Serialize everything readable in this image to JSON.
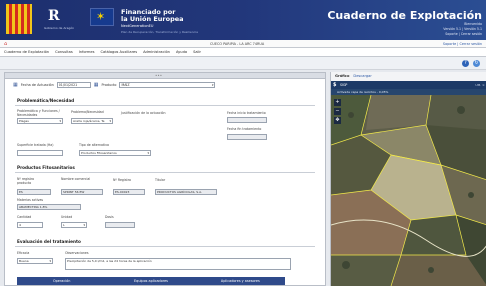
{
  "banner": {
    "logo_letter": "R",
    "logo_sub": "Gobierno de Aragón",
    "financing_line1": "Financiado por",
    "financing_line2": "la Unión Europea",
    "financing_line3": "NextGenerationEU",
    "programme": "Plan de Recuperación, Transformación y Resiliencia",
    "app_title": "Cuaderno de Explotación",
    "app_sub1": "Bienvenido",
    "app_sub2": "Versión 5.1 | Versión 5.1",
    "app_sub3": "Soporte | Cerrar sesión"
  },
  "topbar": {
    "center_text": "CUECO PARIPIA - LA ARC 74RUA",
    "right_text": "Soporte | Cerrar sesión"
  },
  "menu": [
    "Cuaderno de Explotación",
    "Consultas",
    "Informes",
    "Catálogos Auxiliares",
    "Administración",
    "Ayuda",
    "Salir"
  ],
  "form": {
    "fecha_label": "Fecha de Actuación",
    "fecha_value": "01/01/2021",
    "producto_label": "Producto",
    "producto_value": "MAÍZ",
    "section_problema": "Problemática/Necesidad",
    "problematica_label": "Problemática y Funciones / Necesidades",
    "problematica_value": "Plagas",
    "problema_label": "Problema/Necesidad",
    "problema_value": "Araña roja/ácaros, Te",
    "justificacion_label": "Justificación de la actuación",
    "fecha_inicio_label": "Fecha inicio tratamiento",
    "fecha_fin_label": "Fecha fin tratamiento",
    "superficie_label": "Superficie tratada (Ha)",
    "tipo_label": "Tipo de alternativa",
    "tipo_value": "Productos Fitosanitarios",
    "section_productos": "Productos Fitosanitarios",
    "nregistro_label": "Nº registro producto",
    "nregistro_value": "ES",
    "nombre_label": "Nombre comercial",
    "nombre_value": "SPRINT 56 EW",
    "nreg_label": "Nº Registro",
    "nreg_value": "ES-00023",
    "titular_label": "Titular",
    "titular_value": "PRODUCTOS AGRÍCOLAS, S.A.",
    "materia_label": "Materias activas",
    "materia_value": "ABAMECTINA 1,8%",
    "cantidad_label": "Cantidad",
    "cantidad_value": "4",
    "unidad_label": "Unidad",
    "unidad_value": "L",
    "dosis_label": "Dosis",
    "section_evaluacion": "Evaluación del tratamiento",
    "eficacia_label": "Eficacia",
    "eficacia_value": "Buena",
    "observaciones_label": "Observaciones",
    "observaciones_value": "Precipitación de 5,0 l/m2, a las 24 horas de la aplicación",
    "table_headers": [
      "Operación",
      "Equipos aplicadores",
      "Aplicadores y asesores"
    ]
  },
  "map": {
    "tab_grafico": "Gráfico",
    "tab_descarga": "Descargar",
    "toolbar_label": "SIGP",
    "toolbar_right": "UM. 1:",
    "status": "Activada capa de recintos - 0,05%"
  }
}
